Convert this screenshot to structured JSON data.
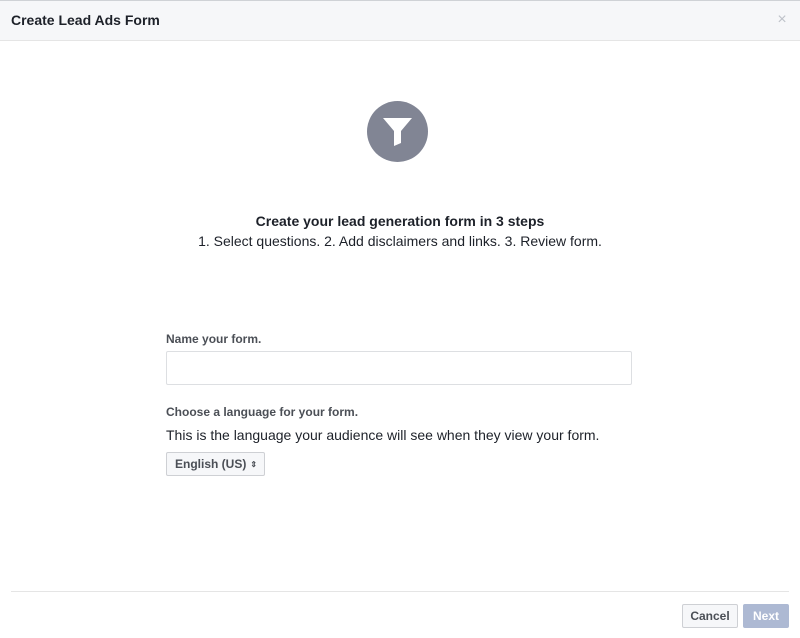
{
  "dialog": {
    "title": "Create Lead Ads Form",
    "close_symbol": "×"
  },
  "intro": {
    "icon": "funnel-icon",
    "title": "Create your lead generation form in 3 steps",
    "steps": "1. Select questions. 2. Add disclaimers and links. 3. Review form."
  },
  "form_name": {
    "label": "Name your form.",
    "value": "",
    "placeholder": ""
  },
  "language": {
    "label": "Choose a language for your form.",
    "help": "This is the language your audience will see when they view your form.",
    "selected": "English (US)",
    "chevron": "⇕"
  },
  "footer": {
    "cancel_label": "Cancel",
    "next_label": "Next"
  },
  "colors": {
    "header_bg": "#f6f7f9",
    "icon_circle": "#818594",
    "next_disabled": "#adb9d3"
  }
}
